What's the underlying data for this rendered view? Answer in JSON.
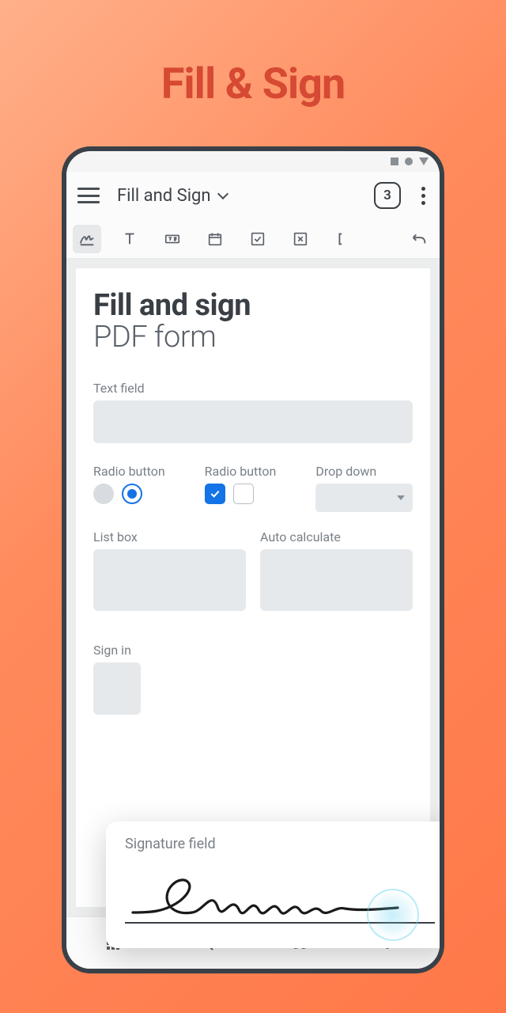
{
  "hero": {
    "title": "Fill & Sign"
  },
  "header": {
    "title": "Fill and Sign",
    "tab_count": "3"
  },
  "toolbar": {
    "tools": [
      "signature",
      "text",
      "textbox",
      "date",
      "checkbox",
      "xbox",
      "bracket",
      "undo"
    ]
  },
  "page": {
    "title_bold": "Fill and sign",
    "title_light": "PDF form",
    "text_field_label": "Text field",
    "radio1_label": "Radio button",
    "radio2_label": "Radio button",
    "dropdown_label": "Drop down",
    "listbox_label": "List box",
    "autocalc_label": "Auto calculate",
    "signin_label": "Sign in"
  },
  "signature_card": {
    "label": "Signature field"
  }
}
